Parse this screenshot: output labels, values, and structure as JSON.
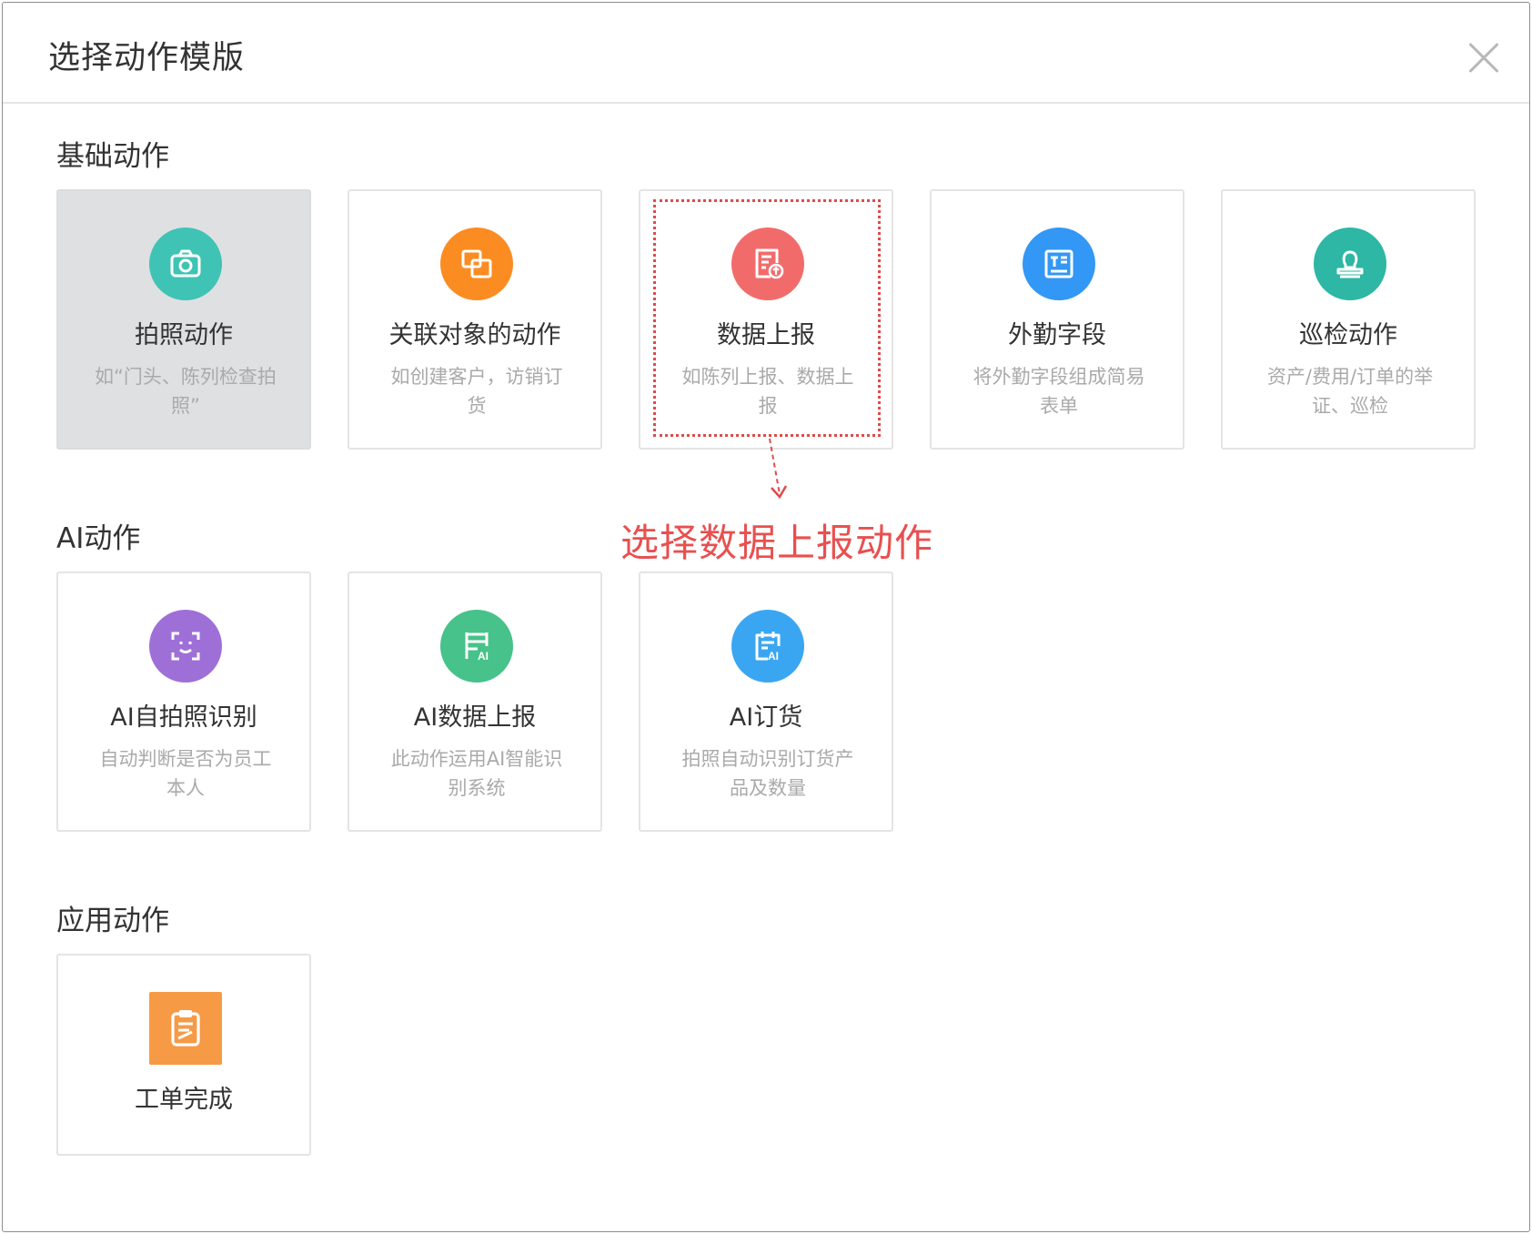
{
  "dialog": {
    "title": "选择动作模版"
  },
  "colors": {
    "teal": "#3fc3b4",
    "orange": "#fb8c22",
    "red": "#f26b6b",
    "blue": "#3397f5",
    "teal_dark": "#2db7a4",
    "purple": "#9f6fd8",
    "green": "#46c28a",
    "sky": "#3aa6f2",
    "app_orange": "#f79a45",
    "annotation": "#e85050"
  },
  "sections": {
    "basic": {
      "title": "基础动作",
      "cards": [
        {
          "title": "拍照动作",
          "desc": "如“门头、陈列检查拍照”",
          "icon": "camera-icon",
          "selected": true
        },
        {
          "title": "关联对象的动作",
          "desc": "如创建客户，访销订货",
          "icon": "link-object-icon"
        },
        {
          "title": "数据上报",
          "desc": "如陈列上报、数据上报",
          "icon": "data-report-icon"
        },
        {
          "title": "外勤字段",
          "desc": "将外勤字段组成简易表单",
          "icon": "form-field-icon"
        },
        {
          "title": "巡检动作",
          "desc": "资产/费用/订单的举证、巡检",
          "icon": "stamp-icon"
        }
      ]
    },
    "ai": {
      "title": "AI动作",
      "cards": [
        {
          "title": "AI自拍照识别",
          "desc": "自动判断是否为员工本人",
          "icon": "face-scan-icon"
        },
        {
          "title": "AI数据上报",
          "desc": "此动作运用AI智能识别系统",
          "icon": "ai-shelf-icon"
        },
        {
          "title": "AI订货",
          "desc": "拍照自动识别订货产品及数量",
          "icon": "ai-order-icon"
        }
      ]
    },
    "app": {
      "title": "应用动作",
      "cards": [
        {
          "title": "工单完成",
          "icon": "work-order-icon"
        }
      ]
    }
  },
  "annotation": {
    "text": "选择数据上报动作"
  }
}
